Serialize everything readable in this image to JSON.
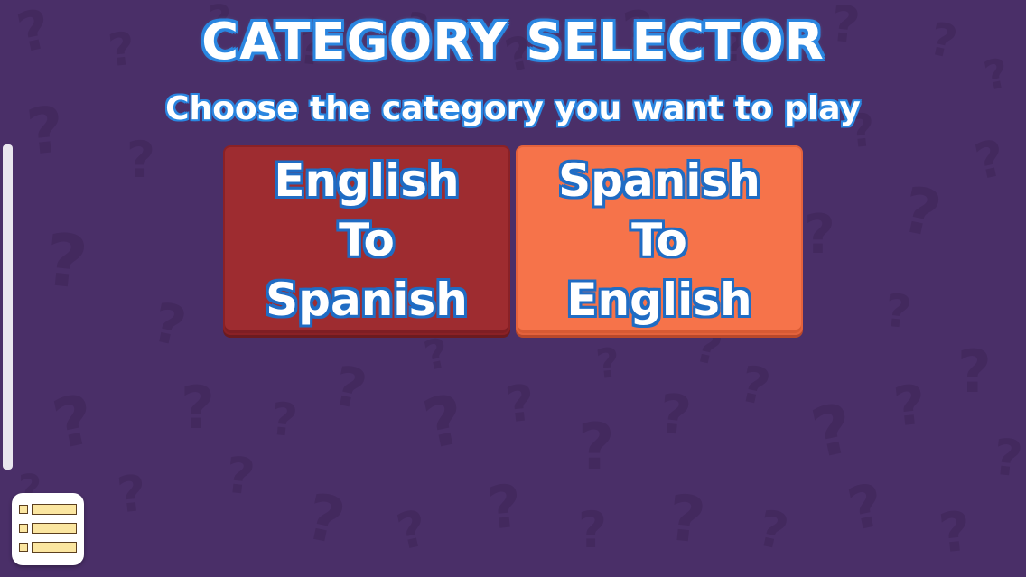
{
  "header": {
    "title": "CATEGORY SELECTOR",
    "subtitle": "Choose the category you want to play"
  },
  "categories": [
    {
      "lines": [
        "English",
        "To",
        "Spanish"
      ],
      "color": "#9e2c30"
    },
    {
      "lines": [
        "Spanish",
        "To",
        "English"
      ],
      "color": "#f6734a"
    }
  ],
  "background": {
    "color": "#4a2f68",
    "pattern_glyph": "?"
  },
  "menu_button": {
    "icon": "list-icon"
  }
}
